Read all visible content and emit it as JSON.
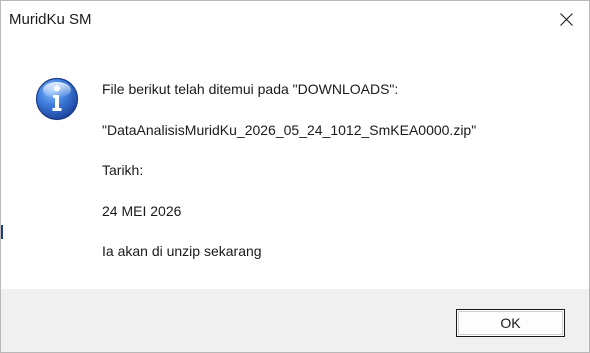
{
  "window": {
    "title": "MuridKu SM"
  },
  "titlebar": {
    "close_icon": "close-icon"
  },
  "message": {
    "icon": "info-icon",
    "accent_color": "#2a5fb5",
    "lines": [
      "File berikut telah ditemui pada \"DOWNLOADS\":",
      "\"DataAnalisisMuridKu_2026_05_24_1012_SmKEA0000.zip\"",
      "Tarikh:",
      "24 MEI 2026",
      "Ia akan di unzip sekarang"
    ]
  },
  "footer": {
    "ok_label": "OK"
  }
}
